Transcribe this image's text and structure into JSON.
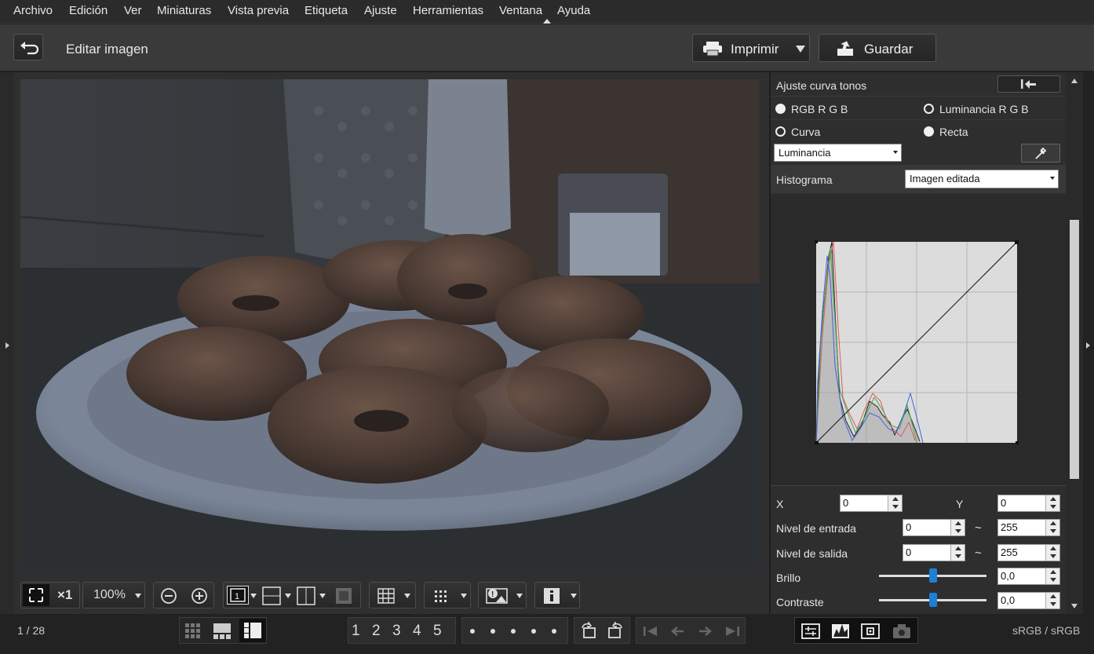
{
  "menubar": {
    "items": [
      "Archivo",
      "Edición",
      "Ver",
      "Miniaturas",
      "Vista previa",
      "Etiqueta",
      "Ajuste",
      "Herramientas",
      "Ventana",
      "Ayuda"
    ]
  },
  "header": {
    "title": "Editar imagen",
    "print_label": "Imprimir",
    "save_label": "Guardar"
  },
  "panel": {
    "section_title": "Ajuste curva tonos",
    "radio_rgb": "RGB R G B",
    "radio_luminance": "Luminancia R G B",
    "radio_curve": "Curva",
    "radio_line": "Recta",
    "channel_select": "Luminancia",
    "histogram_label": "Histograma",
    "histogram_select": "Imagen editada",
    "x_label": "X",
    "x_value": "0",
    "y_label": "Y",
    "y_value": "0",
    "input_level_label": "Nivel de entrada",
    "input_min": "0",
    "input_max": "255",
    "output_level_label": "Nivel de salida",
    "output_min": "0",
    "output_max": "255",
    "tilde": "~",
    "brightness_label": "Brillo",
    "brightness_value": "0,0",
    "contrast_label": "Contraste",
    "contrast_value": "0,0"
  },
  "viewer_toolbar": {
    "zoom_x1": "×1",
    "zoom_level": "100%"
  },
  "status": {
    "image_counter": "1 / 28",
    "color_space": "sRGB / sRGB"
  },
  "ratings": [
    "1",
    "2",
    "3",
    "4",
    "5"
  ]
}
